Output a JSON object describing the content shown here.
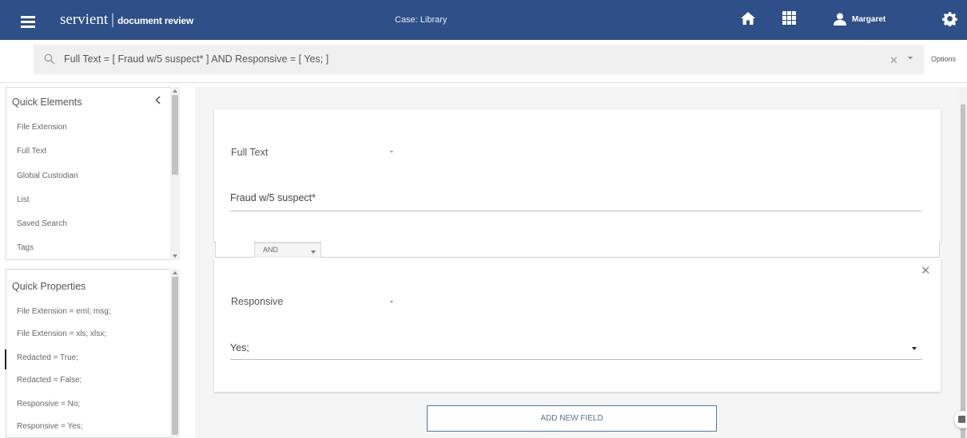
{
  "app": {
    "brand": "servient",
    "separator": "|",
    "subtitle": "document review",
    "case_label": "Case: Library"
  },
  "user": {
    "name": "Margaret"
  },
  "search": {
    "query": "Full Text = [ Fraud w/5 suspect* ] AND Responsive = [ Yes; ]",
    "options_label": "Options"
  },
  "quick_elements": {
    "title": "Quick Elements",
    "items": [
      "File Extension",
      "Full Text",
      "Global Custodian",
      "List",
      "Saved Search",
      "Tags"
    ]
  },
  "quick_properties": {
    "title": "Quick Properties",
    "items": [
      "File Extension = eml; msg;",
      "File Extension = xls; xlsx;",
      "Redacted = True;",
      "Redacted = False;",
      "Responsive = No;",
      "Responsive = Yes;"
    ]
  },
  "query_builder": {
    "fields": [
      {
        "name": "Full Text",
        "value": "Fraud w/5 suspect*"
      },
      {
        "name": "Responsive",
        "value": "Yes;"
      }
    ],
    "operator": "AND",
    "add_button_label": "ADD NEW FIELD"
  },
  "colors": {
    "header_bg": "#2e4f87",
    "accent_border": "#4a78b8"
  },
  "icons": [
    "menu-icon",
    "home-icon",
    "apps-grid-icon",
    "user-icon",
    "gear-icon",
    "search-icon",
    "clear-icon",
    "chevron-down-icon",
    "collapse-chevron-icon",
    "close-icon",
    "chat-icon"
  ]
}
